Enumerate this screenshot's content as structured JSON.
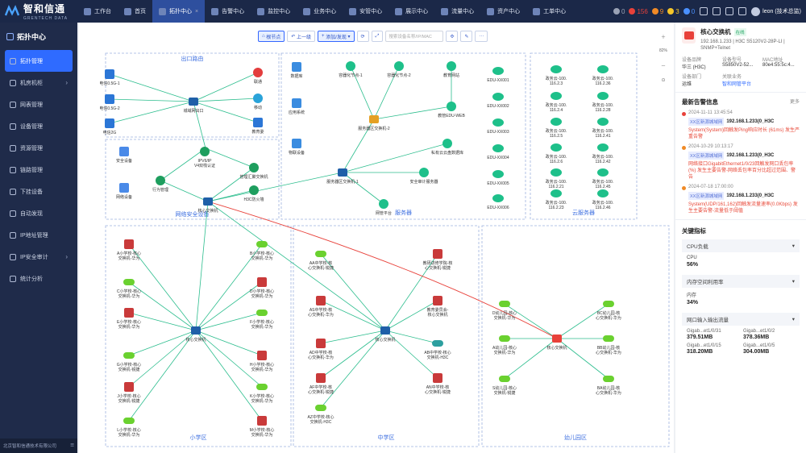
{
  "brand": {
    "name": "智和信通",
    "sub": "GRENTECH DATA"
  },
  "topnav": [
    {
      "label": "工作台"
    },
    {
      "label": "首页"
    },
    {
      "label": "拓扑中心",
      "active": true,
      "closable": true
    },
    {
      "label": "告警中心"
    },
    {
      "label": "监控中心"
    },
    {
      "label": "业务中心"
    },
    {
      "label": "安管中心"
    },
    {
      "label": "展示中心"
    },
    {
      "label": "流量中心"
    },
    {
      "label": "资产中心"
    },
    {
      "label": "工单中心"
    }
  ],
  "topright": {
    "counts": [
      {
        "value": "0",
        "color": "#9aa2b5"
      },
      {
        "value": "156",
        "color": "#e8413a"
      },
      {
        "value": "9",
        "color": "#f08a26"
      },
      {
        "value": "3",
        "color": "#f5c62a"
      },
      {
        "value": "0",
        "color": "#4a90ff"
      }
    ],
    "user": "leon (技术总监)"
  },
  "sidebar": {
    "title": "拓扑中心",
    "items": [
      {
        "label": "拓扑管理",
        "active": true
      },
      {
        "label": "机房机柜",
        "arrow": true
      },
      {
        "label": "网表管理"
      },
      {
        "label": "设备管理"
      },
      {
        "label": "资源管理"
      },
      {
        "label": "链路管理"
      },
      {
        "label": "下挂设备"
      },
      {
        "label": "自动发现"
      },
      {
        "label": "IP地址管理"
      },
      {
        "label": "IP安全审计",
        "arrow": true
      },
      {
        "label": "统计分析"
      }
    ],
    "footer": "北京智和信通技术有限公司"
  },
  "toolbar": {
    "parent_label": "根节点",
    "up_label": "上一级",
    "add_label": "添加/发现",
    "search_placeholder": "搜索设备名称/IP/MAC"
  },
  "zoom": {
    "value": "82%"
  },
  "regions": [
    {
      "title": "出口路由"
    },
    {
      "title": "服务器"
    },
    {
      "title": "云服务器"
    },
    {
      "title": "网络安全设备"
    },
    {
      "title": "小学区"
    },
    {
      "title": "中学区"
    },
    {
      "title": "幼儿园区"
    }
  ],
  "nodes": {
    "exit": [
      "电信0.5G-1",
      "电信0.5G-2",
      "电信2G",
      "联通",
      "移动",
      "教育委",
      "城域网出口"
    ],
    "security": [
      "安全设备",
      "网络设备",
      "IPV6/IPV4双栈认证",
      "管理汇聚交换机",
      "行为管理",
      "H3C防火墙",
      "核心交换机"
    ],
    "servers": [
      "数据库",
      "应用系统",
      "物联设备",
      "容器化节点-1",
      "容器化节点-2",
      "教育网站",
      "教管EDU-WEB",
      "服务器区交换机-2",
      "私有云云盘数据库",
      "服务器区交换机-1",
      "安全审计服务器",
      "网管平台"
    ],
    "edu": [
      "EDU-XX001",
      "EDU-XX002",
      "EDU-XX003",
      "EDU-XX004",
      "EDU-XX005",
      "EDU-XX006"
    ],
    "cloud": [
      "政务云-100.116.2.3",
      "政务云-100.116.2.36",
      "政务云-100.116.2.4",
      "政务云-100.116.2.28",
      "政务云-100.116.2.5",
      "政务云-100.116.2.41",
      "政务云-100.116.2.6",
      "政务云-100.116.2.42",
      "政务云-100.116.2.21",
      "政务云-100.116.2.45",
      "政务云-100.116.2.23",
      "政务云-100.116.2.46"
    ],
    "primary_left": [
      "A小学校-核心交换机-华为",
      "C小学校-核心交换机-华为",
      "E小学校-核心交换机-华为",
      "G小学校-核心交换机-锐捷",
      "J小学校-核心交换机-锐捷",
      "L小学校-核心交换机-华为"
    ],
    "primary_right": [
      "B小学校-核心交换机-华为",
      "D小学校-核心交换机-华为",
      "F小学校-核心交换机-华为",
      "H小学校-核心交换机-华为",
      "K小学校-核心交换机-华为",
      "M小学校-核心交换机-华为"
    ],
    "primary_core": "核心交换机",
    "middle_left": [
      "AA中学校-核心交换机-锐捷",
      "AS中学校-核心交换机-华为",
      "AD中学校-核心交换机-华为",
      "AF中学校-核心交换机-锐捷",
      "AZ中学校-核心交换机-H3C"
    ],
    "middle_right": [
      "教研进修学院-核心交换机-锐捷",
      "教育委员会-核心交换机",
      "AB中学校-核心交换机-H3C",
      "AN中学校-核心交换机-锐捷"
    ],
    "middle_core": "核心交换机",
    "kinder_left": [
      "D幼儿园-核心交换机-华为",
      "A幼儿园-核心交换机-华为",
      "S幼儿园-核心交换机-锐捷"
    ],
    "kinder_right": [
      "BC幼儿园-核心交换机-华为",
      "BB幼儿园-核心交换机-华为",
      "BA幼儿园-核心交换机-华为"
    ],
    "kinder_core": "核心交换机"
  },
  "device": {
    "name": "核心交换机",
    "status": "在线",
    "ip_line": "192.168.1.233 | H3C S5120V2-28P-LI | SNMP+Telnet",
    "fields": [
      {
        "k": "设备品牌",
        "v": "华三 (H3C)"
      },
      {
        "k": "设备型号",
        "v": "S5850V2-52..."
      },
      {
        "k": "MAC地址",
        "v": "80e4:55:5c:4..."
      },
      {
        "k": "设备部门",
        "v": "运维"
      },
      {
        "k": "关联业务",
        "v": "智和网管平台"
      }
    ]
  },
  "alarms": {
    "title": "最新告警信息",
    "more": "更多",
    "items": [
      {
        "time": "2024-11-11 13:45:54",
        "tag": "XX区新源城域网",
        "ip": "192.168.1.233(0_H3C",
        "desc": "System(System)回触发Ping响应时长 (61ms) 发生严重告警",
        "color": "#e8413a"
      },
      {
        "time": "2024-10-29 10:13:17",
        "tag": "XX区新源城域网",
        "ip": "192.168.1.233(0_H3C",
        "desc": "网络接口GigabitEthernet1/0/23回触发网口丢包率(%) 发生主要告警-网络丢包率百分比超过范围、警告",
        "color": "#f08a26"
      },
      {
        "time": "2024-07-18 17:00:00",
        "tag": "XX区新源城域网",
        "ip": "192.168.1.233(0_H3C",
        "desc": "System(UDP/161,162)回触发流量速率(0.0Kbps) 发生主要告警-流量低于阈值",
        "color": "#f08a26"
      }
    ]
  },
  "metrics": {
    "title": "关键指标",
    "cpu": {
      "header": "CPU负载",
      "label": "CPU",
      "value": "56%"
    },
    "mem": {
      "header": "内存空间利用率",
      "label": "内存",
      "value": "34%"
    },
    "net": {
      "header": "网口输入输出流量",
      "items": [
        {
          "k": "Gigab...et1/0/31",
          "v": "379.51MB"
        },
        {
          "k": "Gigab...et1/0/2",
          "v": "378.36MB"
        },
        {
          "k": "Gigab...et1/0/15",
          "v": "318.20MB"
        },
        {
          "k": "Gigab...et1/0/5",
          "v": "304.00MB"
        }
      ]
    }
  },
  "colors": {
    "accent": "#2f6bff",
    "topbar": "#1b2848",
    "sidebar": "#1f2b4a",
    "link": "#2bbd8d",
    "alert_link": "#e8413a"
  }
}
